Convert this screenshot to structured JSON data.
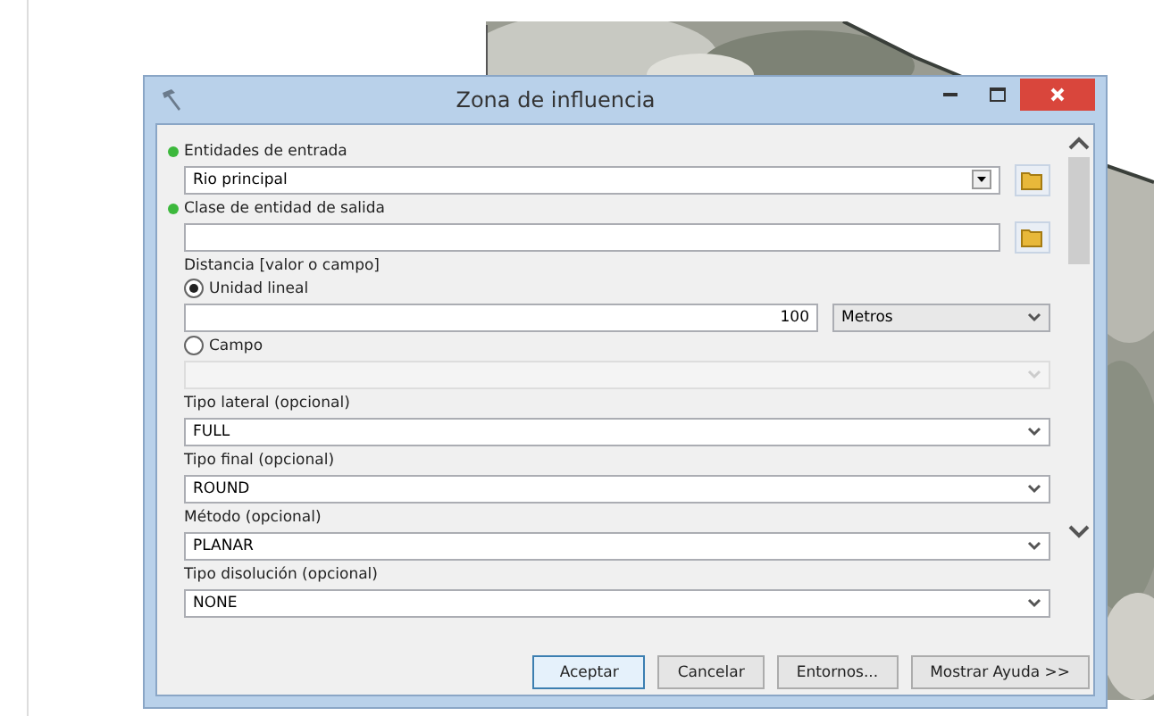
{
  "window": {
    "title": "Zona de influencia"
  },
  "fields": [
    {
      "kind": "combo",
      "label": "Entidades de entrada",
      "required": true,
      "value": "Rio principal"
    },
    {
      "kind": "text",
      "label": "Clase de entidad de salida",
      "required": true
    },
    {
      "kind": "distance",
      "label": "Distancia [valor o campo]",
      "required": false,
      "options": [
        {
          "label": "Unidad lineal",
          "selected": true,
          "value": "100",
          "unit": "Metros"
        },
        {
          "label": "Campo",
          "selected": false,
          "disabled": true
        }
      ]
    },
    {
      "kind": "select",
      "label": "Tipo lateral (opcional)",
      "required": false,
      "value": "FULL"
    },
    {
      "kind": "select",
      "label": "Tipo final (opcional)",
      "required": false,
      "value": "ROUND"
    },
    {
      "kind": "select",
      "label": "Método (opcional)",
      "required": false,
      "value": "PLANAR"
    },
    {
      "kind": "select",
      "label": "Tipo disolución (opcional)",
      "required": false,
      "value": "NONE"
    }
  ],
  "buttons": [
    {
      "label": "Aceptar",
      "default": true
    },
    {
      "label": "Cancelar",
      "default": false
    },
    {
      "label": "Entornos...",
      "default": false
    },
    {
      "label": "Mostrar Ayuda >>",
      "default": false
    }
  ]
}
